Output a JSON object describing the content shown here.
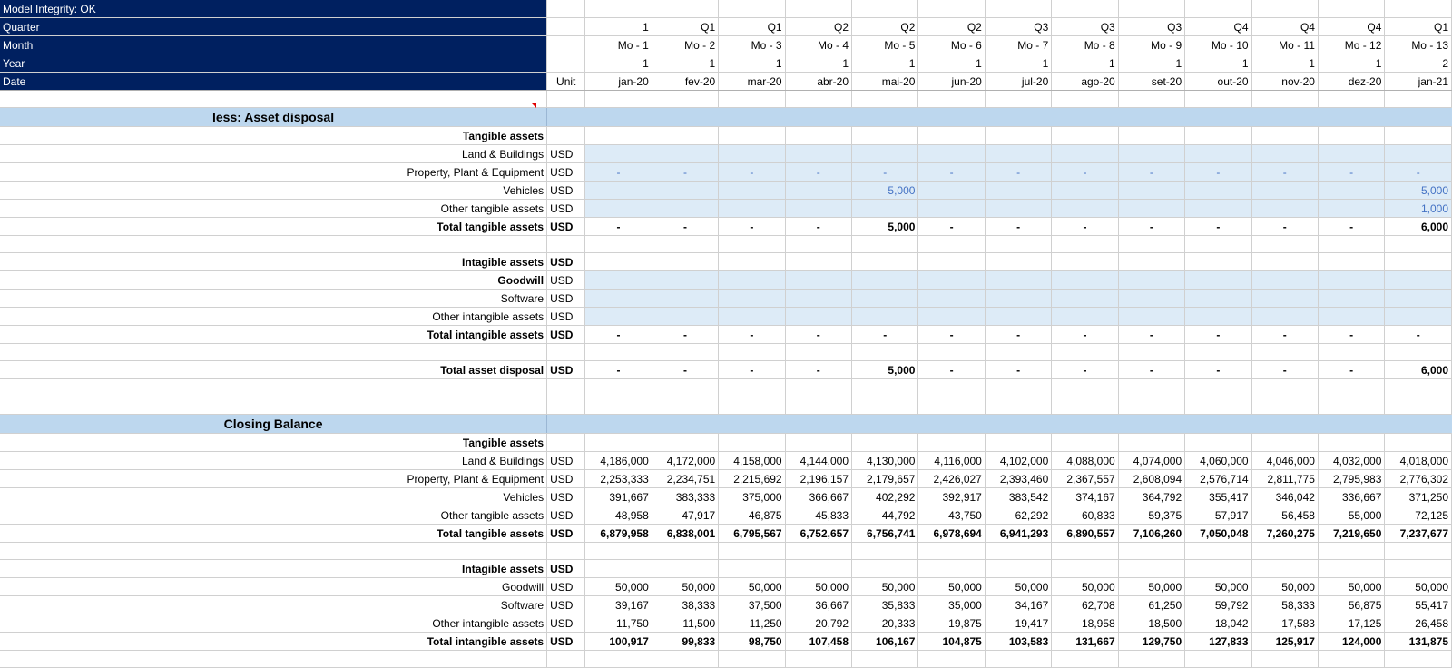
{
  "header": {
    "labels": [
      "Model Integrity: OK",
      "Quarter",
      "Month",
      "Year",
      "Date"
    ],
    "unit_label": "Unit",
    "quarters": [
      "1",
      "Q1",
      "Q1",
      "Q2",
      "Q2",
      "Q2",
      "Q3",
      "Q3",
      "Q3",
      "Q4",
      "Q4",
      "Q4",
      "Q1"
    ],
    "months": [
      "Mo - 1",
      "Mo - 2",
      "Mo - 3",
      "Mo - 4",
      "Mo - 5",
      "Mo - 6",
      "Mo - 7",
      "Mo - 8",
      "Mo - 9",
      "Mo - 10",
      "Mo - 11",
      "Mo - 12",
      "Mo - 13"
    ],
    "years": [
      "1",
      "1",
      "1",
      "1",
      "1",
      "1",
      "1",
      "1",
      "1",
      "1",
      "1",
      "1",
      "2"
    ],
    "dates": [
      "jan-20",
      "fev-20",
      "mar-20",
      "abr-20",
      "mai-20",
      "jun-20",
      "jul-20",
      "ago-20",
      "set-20",
      "out-20",
      "nov-20",
      "dez-20",
      "jan-21"
    ]
  },
  "asset_disposal": {
    "title": "less: Asset disposal",
    "tangible_header": "Tangible assets",
    "land_label": "Land & Buildings",
    "ppe_label": "Property, Plant & Equipment",
    "ppe_values": [
      "-",
      "-",
      "-",
      "-",
      "-",
      "-",
      "-",
      "-",
      "-",
      "-",
      "-",
      "-",
      "-"
    ],
    "vehicles_label": "Vehicles",
    "vehicles_values": [
      "",
      "",
      "",
      "",
      "5,000",
      "",
      "",
      "",
      "",
      "",
      "",
      "",
      "5,000"
    ],
    "other_tangible_label": "Other tangible assets",
    "other_tangible_values": [
      "",
      "",
      "",
      "",
      "",
      "",
      "",
      "",
      "",
      "",
      "",
      "",
      "1,000"
    ],
    "total_tangible_label": "Total tangible assets",
    "total_tangible_values": [
      "-",
      "-",
      "-",
      "-",
      "5,000",
      "-",
      "-",
      "-",
      "-",
      "-",
      "-",
      "-",
      "6,000"
    ],
    "intangible_header": "Intagible assets",
    "goodwill_label": "Goodwill",
    "software_label": "Software",
    "other_intangible_label": "Other intangible assets",
    "total_intangible_label": "Total intangible assets",
    "total_intangible_values": [
      "-",
      "-",
      "-",
      "-",
      "-",
      "-",
      "-",
      "-",
      "-",
      "-",
      "-",
      "-",
      "-"
    ],
    "total_label": "Total asset disposal",
    "total_values": [
      "-",
      "-",
      "-",
      "-",
      "5,000",
      "-",
      "-",
      "-",
      "-",
      "-",
      "-",
      "-",
      "6,000"
    ]
  },
  "closing_balance": {
    "title": "Closing Balance",
    "tangible_header": "Tangible assets",
    "land_label": "Land & Buildings",
    "land_values": [
      "4,186,000",
      "4,172,000",
      "4,158,000",
      "4,144,000",
      "4,130,000",
      "4,116,000",
      "4,102,000",
      "4,088,000",
      "4,074,000",
      "4,060,000",
      "4,046,000",
      "4,032,000",
      "4,018,000"
    ],
    "ppe_label": "Property, Plant & Equipment",
    "ppe_values": [
      "2,253,333",
      "2,234,751",
      "2,215,692",
      "2,196,157",
      "2,179,657",
      "2,426,027",
      "2,393,460",
      "2,367,557",
      "2,608,094",
      "2,576,714",
      "2,811,775",
      "2,795,983",
      "2,776,302"
    ],
    "vehicles_label": "Vehicles",
    "vehicles_values": [
      "391,667",
      "383,333",
      "375,000",
      "366,667",
      "402,292",
      "392,917",
      "383,542",
      "374,167",
      "364,792",
      "355,417",
      "346,042",
      "336,667",
      "371,250"
    ],
    "other_tangible_label": "Other tangible assets",
    "other_tangible_values": [
      "48,958",
      "47,917",
      "46,875",
      "45,833",
      "44,792",
      "43,750",
      "62,292",
      "60,833",
      "59,375",
      "57,917",
      "56,458",
      "55,000",
      "72,125"
    ],
    "total_tangible_label": "Total tangible assets",
    "total_tangible_values": [
      "6,879,958",
      "6,838,001",
      "6,795,567",
      "6,752,657",
      "6,756,741",
      "6,978,694",
      "6,941,293",
      "6,890,557",
      "7,106,260",
      "7,050,048",
      "7,260,275",
      "7,219,650",
      "7,237,677"
    ],
    "intangible_header": "Intagible assets",
    "goodwill_label": "Goodwill",
    "goodwill_values": [
      "50,000",
      "50,000",
      "50,000",
      "50,000",
      "50,000",
      "50,000",
      "50,000",
      "50,000",
      "50,000",
      "50,000",
      "50,000",
      "50,000",
      "50,000"
    ],
    "software_label": "Software",
    "software_values": [
      "39,167",
      "38,333",
      "37,500",
      "36,667",
      "35,833",
      "35,000",
      "34,167",
      "62,708",
      "61,250",
      "59,792",
      "58,333",
      "56,875",
      "55,417"
    ],
    "other_intangible_label": "Other intangible assets",
    "other_intangible_values": [
      "11,750",
      "11,500",
      "11,250",
      "20,792",
      "20,333",
      "19,875",
      "19,417",
      "18,958",
      "18,500",
      "18,042",
      "17,583",
      "17,125",
      "26,458"
    ],
    "total_intangible_label": "Total intangible assets",
    "total_intangible_values": [
      "100,917",
      "99,833",
      "98,750",
      "107,458",
      "106,167",
      "104,875",
      "103,583",
      "131,667",
      "129,750",
      "127,833",
      "125,917",
      "124,000",
      "131,875"
    ]
  },
  "unit": "USD",
  "colors": {
    "header_navy": "#002060",
    "section_blue": "#bdd7ee",
    "input_fill": "#ddebf7",
    "input_text": "#4472c4"
  }
}
